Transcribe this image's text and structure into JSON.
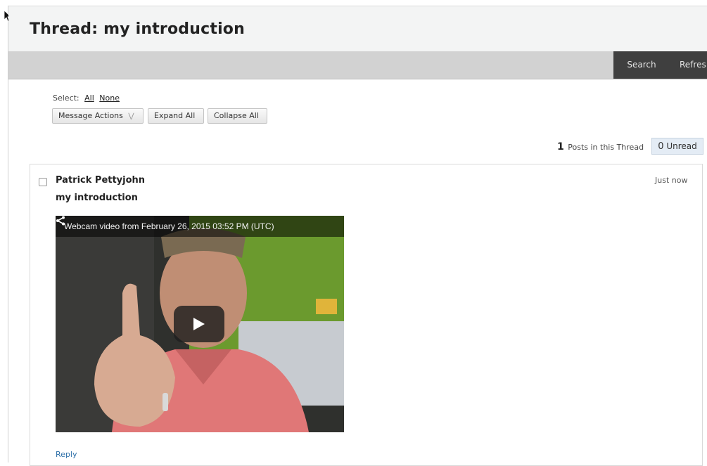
{
  "thread": {
    "title": "Thread: my introduction"
  },
  "toolbar": {
    "search_label": "Search",
    "refresh_label": "Refres"
  },
  "selection": {
    "label": "Select:",
    "all": "All",
    "none": "None"
  },
  "actions": {
    "message_actions": "Message Actions",
    "expand_all": "Expand All",
    "collapse_all": "Collapse All"
  },
  "summary": {
    "posts_count": "1",
    "posts_label": "Posts in this Thread",
    "unread_count": "0",
    "unread_label": "Unread"
  },
  "post": {
    "author": "Patrick Pettyjohn",
    "subject": "my introduction",
    "time": "Just now",
    "reply_label": "Reply",
    "video": {
      "title": "Webcam video from February 26, 2015 03:52 PM (UTC)"
    }
  },
  "colors": {
    "header_bg": "#f3f4f4",
    "toolbar_bg": "#d2d2d2",
    "toolbar_button_bg": "#3f3f3f",
    "link": "#2d6fa8",
    "unread_badge_bg": "#e4ecf5"
  },
  "icons": {
    "dropdown": "chevron-down-icon",
    "share": "share-icon",
    "play": "play-icon"
  }
}
